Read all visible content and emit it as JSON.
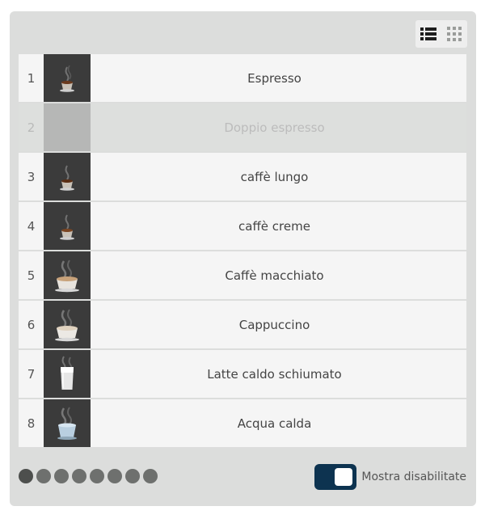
{
  "view_toggle": {
    "list_icon": "list-view-icon",
    "grid_icon": "grid-view-icon",
    "active": "list"
  },
  "items": [
    {
      "number": "1",
      "label": "Espresso",
      "icon": "espresso-cup-icon",
      "disabled": false
    },
    {
      "number": "2",
      "label": "Doppio espresso",
      "icon": "",
      "disabled": true
    },
    {
      "number": "3",
      "label": "caffè lungo",
      "icon": "espresso-cup-icon",
      "disabled": false
    },
    {
      "number": "4",
      "label": "caffè creme",
      "icon": "espresso-cup-icon",
      "disabled": false
    },
    {
      "number": "5",
      "label": "Caffè macchiato",
      "icon": "cappuccino-cup-icon",
      "disabled": false
    },
    {
      "number": "6",
      "label": "Cappuccino",
      "icon": "cappuccino-cup-icon",
      "disabled": false
    },
    {
      "number": "7",
      "label": "Latte caldo schiumato",
      "icon": "milk-glass-icon",
      "disabled": false
    },
    {
      "number": "8",
      "label": "Acqua calda",
      "icon": "water-cup-icon",
      "disabled": false
    }
  ],
  "pagination": {
    "page_count": 8,
    "active_page": 1
  },
  "show_disabled": {
    "label": "Mostra disabilitate",
    "on": true,
    "accent_color": "#0d3350"
  }
}
